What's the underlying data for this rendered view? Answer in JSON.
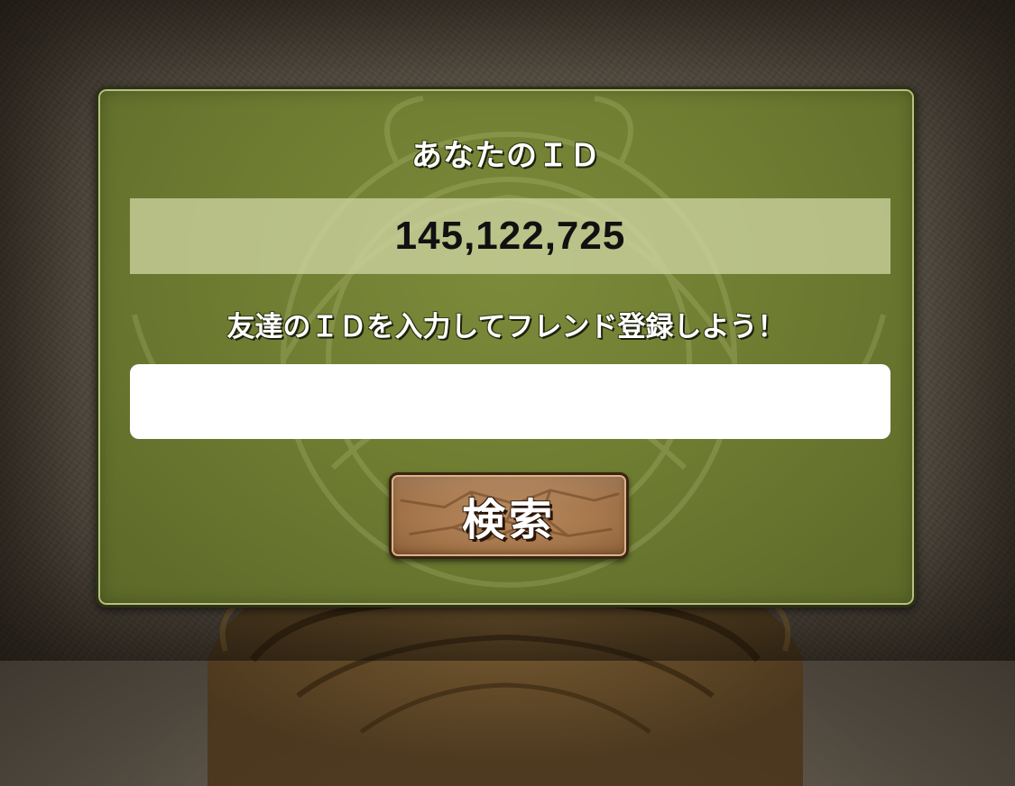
{
  "dialog": {
    "title": "あなたのＩＤ",
    "your_id": "145,122,725",
    "instruction": "友達のＩＤを入力してフレンド登録しよう！",
    "friend_id_input": {
      "value": "",
      "placeholder": ""
    },
    "search_button_label": "検索"
  },
  "colors": {
    "panel_green": "#6f7d32",
    "panel_border": "#2d3214",
    "id_box": "#cdd4a0",
    "button_brown": "#a4754a",
    "background_stone": "#5b5347"
  },
  "icons": {
    "background": "dragon-emblem",
    "button_texture": "stone-crack"
  }
}
